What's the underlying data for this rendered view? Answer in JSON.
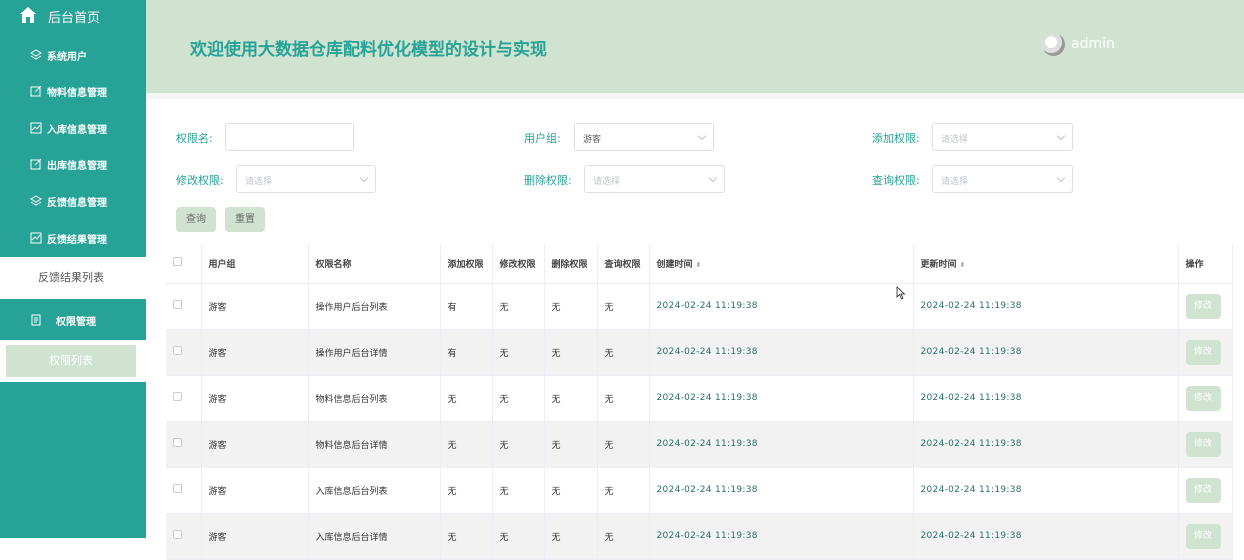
{
  "sidebar": {
    "home_label": "后台首页",
    "items": [
      {
        "icon": "layers-icon",
        "label": "系统用户"
      },
      {
        "icon": "edit-icon",
        "label": "物料信息管理"
      },
      {
        "icon": "chart-icon",
        "label": "入库信息管理"
      },
      {
        "icon": "edit-icon",
        "label": "出库信息管理"
      },
      {
        "icon": "layers-icon",
        "label": "反馈信息管理"
      },
      {
        "icon": "chart-icon",
        "label": "反馈结果管理"
      }
    ],
    "submenu_feedback": "反馈结果列表",
    "permission_label": "权限管理",
    "submenu_permission": "权限列表"
  },
  "header": {
    "title": "欢迎使用大数据仓库配料优化模型的设计与实现",
    "username": "admin"
  },
  "filters": {
    "perm_name_label": "权限名:",
    "user_group_label": "用户组:",
    "user_group_value": "游客",
    "add_perm_label": "添加权限:",
    "edit_perm_label": "修改权限:",
    "delete_perm_label": "删除权限:",
    "query_perm_label": "查询权限:",
    "placeholder": "请选择",
    "query_button": "查询",
    "reset_button": "重置"
  },
  "table": {
    "headers": [
      "用户组",
      "权限名称",
      "添加权限",
      "修改权限",
      "删除权限",
      "查询权限",
      "创建时间",
      "更新时间",
      "操作"
    ],
    "edit_label": "修改",
    "rows": [
      [
        "游客",
        "操作用户后台列表",
        "有",
        "无",
        "无",
        "无",
        "2024-02-24 11:19:38",
        "2024-02-24 11:19:38"
      ],
      [
        "游客",
        "操作用户后台详情",
        "有",
        "无",
        "无",
        "无",
        "2024-02-24 11:19:38",
        "2024-02-24 11:19:38"
      ],
      [
        "游客",
        "物料信息后台列表",
        "无",
        "无",
        "无",
        "无",
        "2024-02-24 11:19:38",
        "2024-02-24 11:19:38"
      ],
      [
        "游客",
        "物料信息后台详情",
        "无",
        "无",
        "无",
        "无",
        "2024-02-24 11:19:38",
        "2024-02-24 11:19:38"
      ],
      [
        "游客",
        "入库信息后台列表",
        "无",
        "无",
        "无",
        "无",
        "2024-02-24 11:19:38",
        "2024-02-24 11:19:38"
      ],
      [
        "游客",
        "入库信息后台详情",
        "无",
        "无",
        "无",
        "无",
        "2024-02-24 11:19:38",
        "2024-02-24 11:19:38"
      ]
    ]
  },
  "colors": {
    "accent": "#26a296",
    "header_bg": "#cfe3d0",
    "button_bg": "#cfe3d0"
  }
}
